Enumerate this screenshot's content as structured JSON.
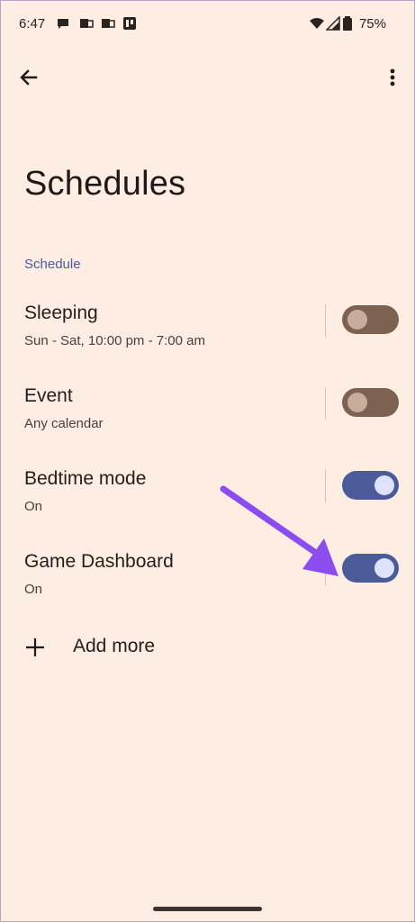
{
  "status_bar": {
    "time": "6:47",
    "battery": "75%"
  },
  "app_bar": {
    "back_icon": "arrow-back-icon",
    "menu_icon": "more-vert-icon"
  },
  "page": {
    "title": "Schedules"
  },
  "section": {
    "label": "Schedule"
  },
  "rows": [
    {
      "title": "Sleeping",
      "subtitle": "Sun - Sat, 10:00 pm - 7:00 am",
      "enabled": false
    },
    {
      "title": "Event",
      "subtitle": "Any calendar",
      "enabled": false
    },
    {
      "title": "Bedtime mode",
      "subtitle": "On",
      "enabled": true
    },
    {
      "title": "Game Dashboard",
      "subtitle": "On",
      "enabled": true
    }
  ],
  "add_more": {
    "label": "Add more"
  },
  "colors": {
    "background": "#fdede2",
    "toggle_on": "#4b5b9a",
    "toggle_off": "#7d6252",
    "accent_section": "#4a5aa0",
    "annotation_arrow": "#8b4cf0"
  }
}
